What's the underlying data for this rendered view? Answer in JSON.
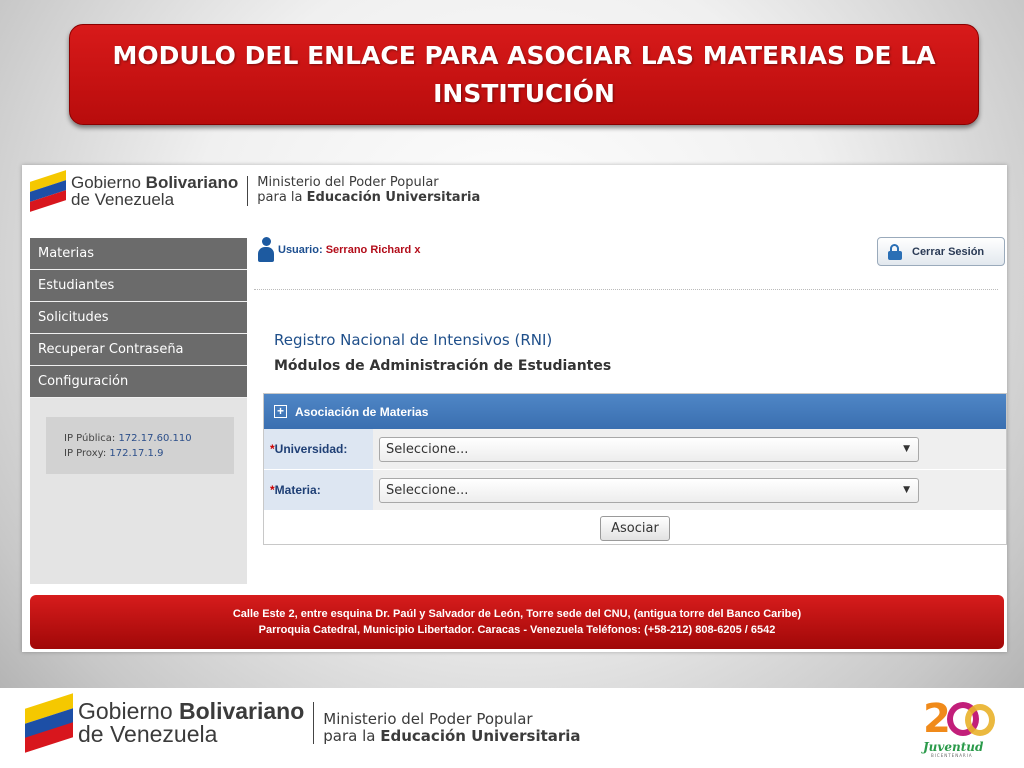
{
  "slide": {
    "title_line1": "MODULO DEL ENLACE PARA ASOCIAR LAS MATERIAS DE LA",
    "title_line2": "INSTITUCIÓN"
  },
  "header": {
    "gob_part1": "Gobierno ",
    "gob_part2": "Bolivariano",
    "gob_line2": "de Venezuela",
    "min_line1": "Ministerio del Poder Popular",
    "min_line2_pre": "para la ",
    "min_line2_bold": "Educación Universitaria"
  },
  "sidebar": {
    "items": [
      {
        "label": "Materias"
      },
      {
        "label": "Estudiantes"
      },
      {
        "label": "Solicitudes"
      },
      {
        "label": "Recuperar Contraseña"
      },
      {
        "label": "Configuración"
      }
    ],
    "ip_public_label": "IP Pública: ",
    "ip_public_value": "172.17.60.110",
    "ip_proxy_label": "IP Proxy: ",
    "ip_proxy_value": "172.17.1.9"
  },
  "user": {
    "label": "Usuario: ",
    "name": "Serrano Richard x",
    "logout_label": "Cerrar Sesión"
  },
  "main": {
    "title": "Registro Nacional de Intensivos (RNI)",
    "subtitle": "Módulos de Administración de Estudiantes",
    "panel_title": "Asociación de Materias",
    "required_mark": "*",
    "fields": [
      {
        "label": "Universidad:",
        "value": "Seleccione..."
      },
      {
        "label": "Materia:",
        "value": "Seleccione..."
      }
    ],
    "submit_label": "Asociar"
  },
  "footer": {
    "line1": "Calle Este 2, entre esquina Dr. Paúl y Salvador de León, Torre sede del CNU, (antigua torre del Banco Caribe)",
    "line2": "Parroquia Catedral, Municipio Libertador. Caracas - Venezuela Teléfonos: (+58-212) 808-6205 / 6542"
  },
  "badge": {
    "number": "2",
    "word": "Juventud",
    "sub": "BICENTENARIA"
  }
}
